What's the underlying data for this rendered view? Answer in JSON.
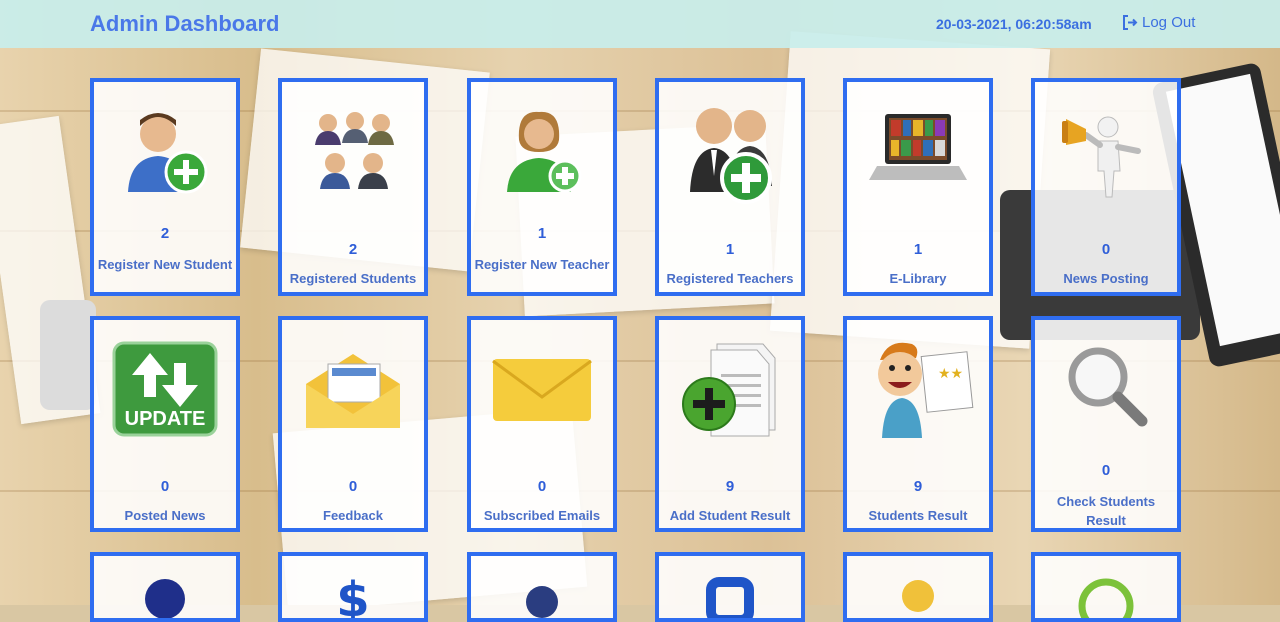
{
  "header": {
    "title": "Admin Dashboard",
    "datetime": "20-03-2021, 06:20:58am",
    "logout_label": "Log Out"
  },
  "cards": [
    {
      "count": "2",
      "label": "Register New Student",
      "icon": "add-user-icon"
    },
    {
      "count": "2",
      "label": "Registered Students",
      "icon": "group-icon"
    },
    {
      "count": "1",
      "label": "Register New Teacher",
      "icon": "add-teacher-icon"
    },
    {
      "count": "1",
      "label": "Registered Teachers",
      "icon": "teachers-add-icon"
    },
    {
      "count": "1",
      "label": "E-Library",
      "icon": "laptop-library-icon"
    },
    {
      "count": "0",
      "label": "News Posting",
      "icon": "megaphone-icon"
    },
    {
      "count": "0",
      "label": "Posted News",
      "icon": "update-icon"
    },
    {
      "count": "0",
      "label": "Feedback",
      "icon": "open-envelope-icon"
    },
    {
      "count": "0",
      "label": "Subscribed Emails",
      "icon": "envelope-icon"
    },
    {
      "count": "9",
      "label": "Add Student Result",
      "icon": "document-add-icon"
    },
    {
      "count": "9",
      "label": "Students Result",
      "icon": "student-certificate-icon"
    },
    {
      "count": "0",
      "label": "Check Students Result",
      "icon": "magnifier-icon"
    }
  ],
  "partial_row_icons": [
    "blue-orb-icon",
    "dollar-icon",
    "person-icon",
    "square-icon",
    "yellow-person-icon",
    "green-ring-icon"
  ],
  "colors": {
    "accent": "#2f6df0",
    "header_bg": "#c8eeeb",
    "text": "#3b6fe0"
  }
}
